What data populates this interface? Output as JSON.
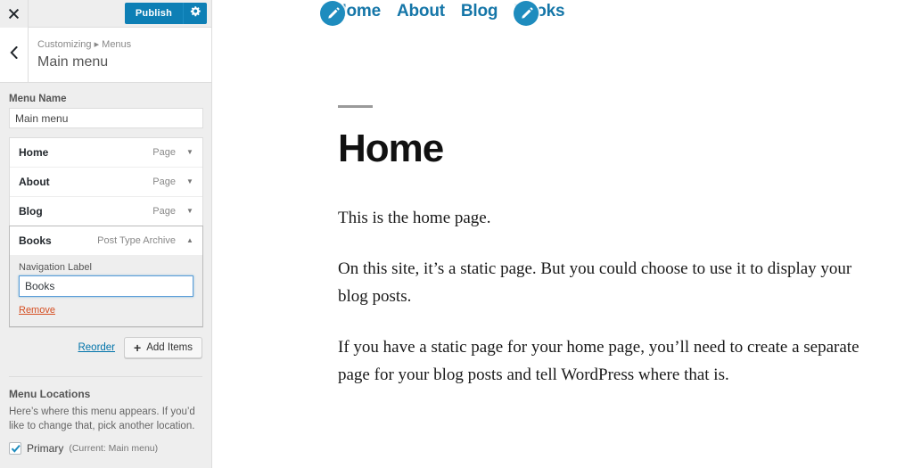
{
  "customizer": {
    "close_icon": "close-icon",
    "publish_label": "Publish",
    "gear_icon": "gear-icon",
    "back_icon": "chevron-left-icon",
    "breadcrumb": "Customizing ▸ Menus",
    "panel_title": "Main menu",
    "menu_name_label": "Menu Name",
    "menu_name_value": "Main menu",
    "menu_items": [
      {
        "label": "Home",
        "type": "Page",
        "toggle": "▼",
        "expanded": false
      },
      {
        "label": "About",
        "type": "Page",
        "toggle": "▼",
        "expanded": false
      },
      {
        "label": "Blog",
        "type": "Page",
        "toggle": "▼",
        "expanded": false
      },
      {
        "label": "Books",
        "type": "Post Type Archive",
        "toggle": "▲",
        "expanded": true
      }
    ],
    "expanded_item": {
      "nav_label_caption": "Navigation Label",
      "nav_label_value": "Books",
      "remove_label": "Remove"
    },
    "reorder_label": "Reorder",
    "add_items_label": "Add Items",
    "add_items_icon": "plus-icon",
    "locations": {
      "title": "Menu Locations",
      "description": "Here’s where this menu appears. If you’d like to change that, pick another location.",
      "checkbox_icon": "checkmark-icon",
      "checked": true,
      "name": "Primary",
      "current": "(Current: Main menu)"
    },
    "colors": {
      "publish_blue": "#0d7fb5",
      "link_blue": "#0073aa",
      "remove_red": "#d54e21",
      "panel_bg": "#eeeeee",
      "focus_blue": "#5b9dd9"
    }
  },
  "preview": {
    "nav": [
      {
        "label": "Home"
      },
      {
        "label": "About"
      },
      {
        "label": "Blog"
      },
      {
        "label": "Books"
      }
    ],
    "edit_icons": [
      {
        "name": "edit-pencil-site-title",
        "icon": "pencil-icon"
      },
      {
        "name": "edit-pencil-menu",
        "icon": "pencil-icon"
      }
    ],
    "page_title": "Home",
    "paragraphs": [
      "This is the home page.",
      "On this site, it’s a static page. But you could choose to use it to display your blog posts.",
      "If you have a static page for your home page, you’ll need to create a separate page for your blog posts and tell WordPress where that is."
    ],
    "colors": {
      "nav_link": "#1576a8",
      "pencil_bg": "#1e8cbe",
      "rule": "#9a9a9a"
    }
  }
}
